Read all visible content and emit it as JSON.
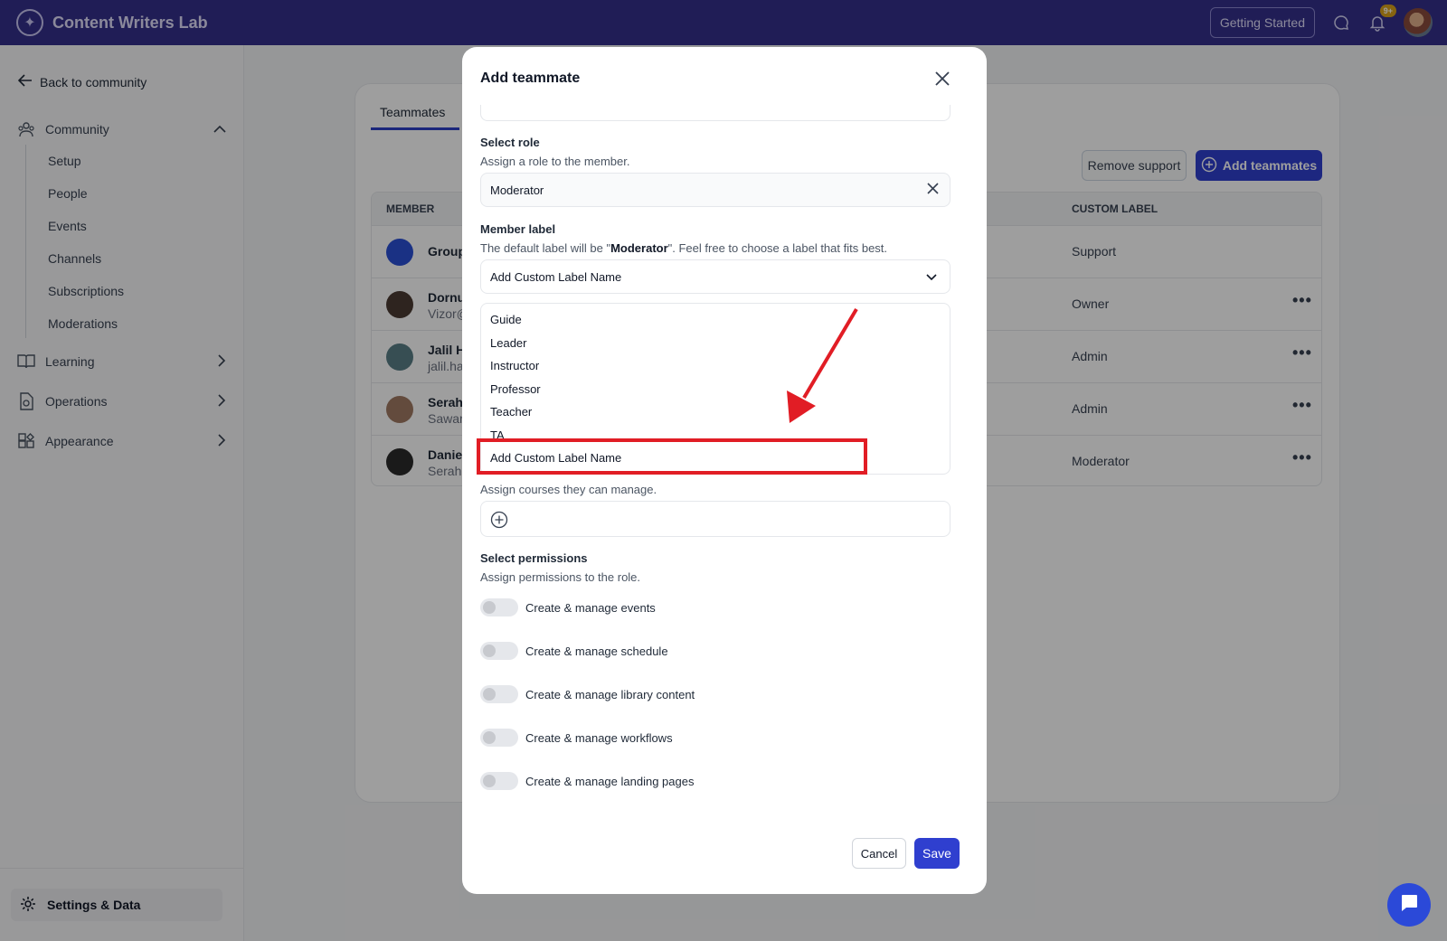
{
  "app": {
    "name": "Content Writers Lab"
  },
  "topbar": {
    "getting_started": "Getting Started",
    "notif_count": "9+"
  },
  "sidebar": {
    "back": "Back to community",
    "community": "Community",
    "sub_items": [
      "Setup",
      "People",
      "Events",
      "Channels",
      "Subscriptions",
      "Moderations"
    ],
    "learning": "Learning",
    "operations": "Operations",
    "appearance": "Appearance",
    "settings": "Settings & Data"
  },
  "main": {
    "tab": "Teammates",
    "remove_support": "Remove support",
    "add_teammates": "Add teammates",
    "headers": {
      "member": "MEMBER",
      "custom_label": "CUSTOM LABEL"
    },
    "rows": [
      {
        "name": "Group",
        "email": "",
        "label": "Support",
        "avatar_color": "#2a4fd6"
      },
      {
        "name": "Dornu",
        "email": "Vizor@",
        "label": "Owner",
        "avatar_color": "#4b3a32"
      },
      {
        "name": "Jalil H",
        "email": "jalil.ha",
        "label": "Admin",
        "avatar_color": "#5a7f86"
      },
      {
        "name": "Serah",
        "email": "Sawar",
        "label": "Admin",
        "avatar_color": "#a17a63"
      },
      {
        "name": "Daniel",
        "email": "Serahi",
        "label": "Moderator",
        "avatar_color": "#2b2b2b"
      }
    ]
  },
  "modal": {
    "title": "Add teammate",
    "role": {
      "label": "Select role",
      "help": "Assign a role to the member.",
      "value": "Moderator"
    },
    "member_label": {
      "label": "Member label",
      "help_prefix": "The default label will be \"",
      "help_bold": "Moderator",
      "help_suffix": "\". Feel free to choose a label that fits best.",
      "value": "Add Custom Label Name",
      "options": [
        "Guide",
        "Leader",
        "Instructor",
        "Professor",
        "Teacher",
        "TA",
        "Add Custom Label Name"
      ]
    },
    "courses_help": "Assign courses they can manage.",
    "permissions": {
      "label": "Select permissions",
      "help": "Assign permissions to the role.",
      "items": [
        "Create & manage events",
        "Create & manage schedule",
        "Create & manage library content",
        "Create & manage workflows",
        "Create & manage landing pages"
      ]
    },
    "cancel": "Cancel",
    "save": "Save"
  },
  "colors": {
    "brand": "#34308c",
    "primary": "#2f3fcf",
    "annotation": "#e11d25"
  }
}
